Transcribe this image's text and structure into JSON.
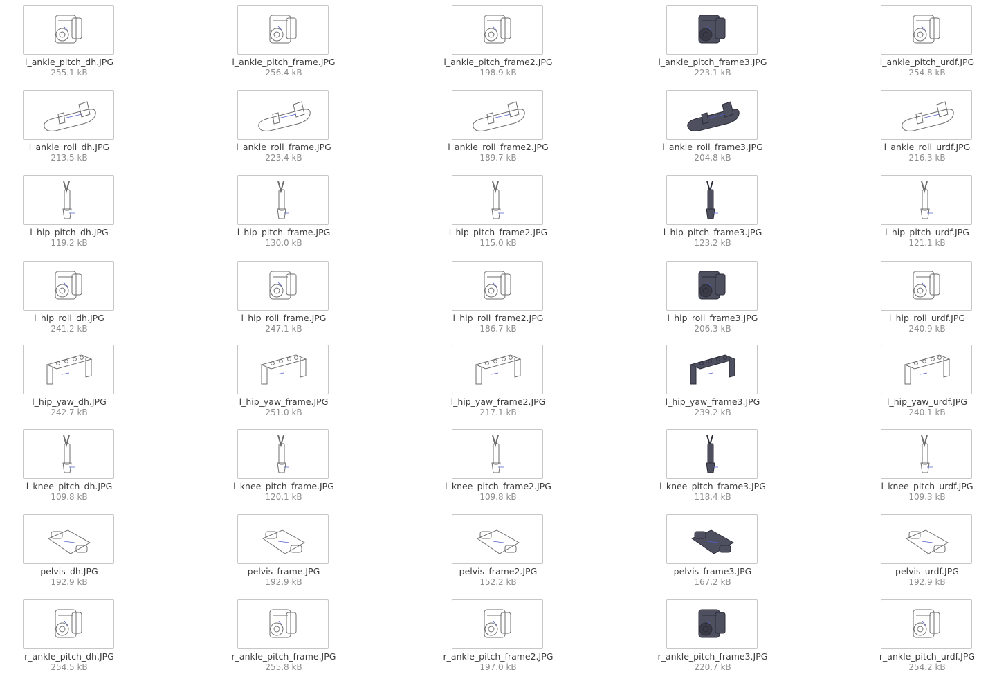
{
  "files": [
    {
      "name": "l_ankle_pitch_dh.JPG",
      "size": "255.1 kB",
      "icon": "actuator-icon"
    },
    {
      "name": "l_ankle_pitch_frame.JPG",
      "size": "256.4 kB",
      "icon": "actuator-icon"
    },
    {
      "name": "l_ankle_pitch_frame2.JPG",
      "size": "198.9 kB",
      "icon": "actuator-icon"
    },
    {
      "name": "l_ankle_pitch_frame3.JPG",
      "size": "223.1 kB",
      "icon": "actuator-icon",
      "dark": true
    },
    {
      "name": "l_ankle_pitch_urdf.JPG",
      "size": "254.8 kB",
      "icon": "actuator-icon"
    },
    {
      "name": "l_ankle_roll_dh.JPG",
      "size": "213.5 kB",
      "icon": "foot-plate-icon"
    },
    {
      "name": "l_ankle_roll_frame.JPG",
      "size": "223.4 kB",
      "icon": "foot-plate-icon"
    },
    {
      "name": "l_ankle_roll_frame2.JPG",
      "size": "189.7 kB",
      "icon": "foot-plate-icon"
    },
    {
      "name": "l_ankle_roll_frame3.JPG",
      "size": "204.8 kB",
      "icon": "foot-plate-icon",
      "dark": true
    },
    {
      "name": "l_ankle_roll_urdf.JPG",
      "size": "216.3 kB",
      "icon": "foot-plate-icon"
    },
    {
      "name": "l_hip_pitch_dh.JPG",
      "size": "119.2 kB",
      "icon": "leg-link-icon"
    },
    {
      "name": "l_hip_pitch_frame.JPG",
      "size": "130.0 kB",
      "icon": "leg-link-icon"
    },
    {
      "name": "l_hip_pitch_frame2.JPG",
      "size": "115.0 kB",
      "icon": "leg-link-icon"
    },
    {
      "name": "l_hip_pitch_frame3.JPG",
      "size": "123.2 kB",
      "icon": "leg-link-icon",
      "dark": true
    },
    {
      "name": "l_hip_pitch_urdf.JPG",
      "size": "121.1 kB",
      "icon": "leg-link-icon"
    },
    {
      "name": "l_hip_roll_dh.JPG",
      "size": "241.2 kB",
      "icon": "actuator-icon"
    },
    {
      "name": "l_hip_roll_frame.JPG",
      "size": "247.1 kB",
      "icon": "actuator-icon"
    },
    {
      "name": "l_hip_roll_frame2.JPG",
      "size": "186.7 kB",
      "icon": "actuator-icon"
    },
    {
      "name": "l_hip_roll_frame3.JPG",
      "size": "206.3 kB",
      "icon": "actuator-icon",
      "dark": true
    },
    {
      "name": "l_hip_roll_urdf.JPG",
      "size": "240.9 kB",
      "icon": "actuator-icon"
    },
    {
      "name": "l_hip_yaw_dh.JPG",
      "size": "242.7 kB",
      "icon": "bracket-icon"
    },
    {
      "name": "l_hip_yaw_frame.JPG",
      "size": "251.0 kB",
      "icon": "bracket-icon"
    },
    {
      "name": "l_hip_yaw_frame2.JPG",
      "size": "217.1 kB",
      "icon": "bracket-icon"
    },
    {
      "name": "l_hip_yaw_frame3.JPG",
      "size": "239.2 kB",
      "icon": "bracket-icon",
      "dark": true
    },
    {
      "name": "l_hip_yaw_urdf.JPG",
      "size": "240.1 kB",
      "icon": "bracket-icon"
    },
    {
      "name": "l_knee_pitch_dh.JPG",
      "size": "109.8 kB",
      "icon": "leg-link-icon"
    },
    {
      "name": "l_knee_pitch_frame.JPG",
      "size": "120.1 kB",
      "icon": "leg-link-icon"
    },
    {
      "name": "l_knee_pitch_frame2.JPG",
      "size": "109.8 kB",
      "icon": "leg-link-icon"
    },
    {
      "name": "l_knee_pitch_frame3.JPG",
      "size": "118.4 kB",
      "icon": "leg-link-icon",
      "dark": true
    },
    {
      "name": "l_knee_pitch_urdf.JPG",
      "size": "109.3 kB",
      "icon": "leg-link-icon"
    },
    {
      "name": "pelvis_dh.JPG",
      "size": "192.9 kB",
      "icon": "pelvis-plate-icon"
    },
    {
      "name": "pelvis_frame.JPG",
      "size": "192.9 kB",
      "icon": "pelvis-plate-icon"
    },
    {
      "name": "pelvis_frame2.JPG",
      "size": "152.2 kB",
      "icon": "pelvis-plate-icon"
    },
    {
      "name": "pelvis_frame3.JPG",
      "size": "167.2 kB",
      "icon": "pelvis-plate-icon",
      "dark": true
    },
    {
      "name": "pelvis_urdf.JPG",
      "size": "192.9 kB",
      "icon": "pelvis-plate-icon"
    },
    {
      "name": "r_ankle_pitch_dh.JPG",
      "size": "254.5 kB",
      "icon": "actuator-icon"
    },
    {
      "name": "r_ankle_pitch_frame.JPG",
      "size": "255.8 kB",
      "icon": "actuator-icon"
    },
    {
      "name": "r_ankle_pitch_frame2.JPG",
      "size": "197.0 kB",
      "icon": "actuator-icon"
    },
    {
      "name": "r_ankle_pitch_frame3.JPG",
      "size": "220.7 kB",
      "icon": "actuator-icon",
      "dark": true
    },
    {
      "name": "r_ankle_pitch_urdf.JPG",
      "size": "254.2 kB",
      "icon": "actuator-icon"
    }
  ],
  "colors": {
    "line": "#6e6e6e",
    "dark_fill": "#4e5060",
    "dark_stroke": "#2c2d38",
    "accent": "#5560c8"
  }
}
